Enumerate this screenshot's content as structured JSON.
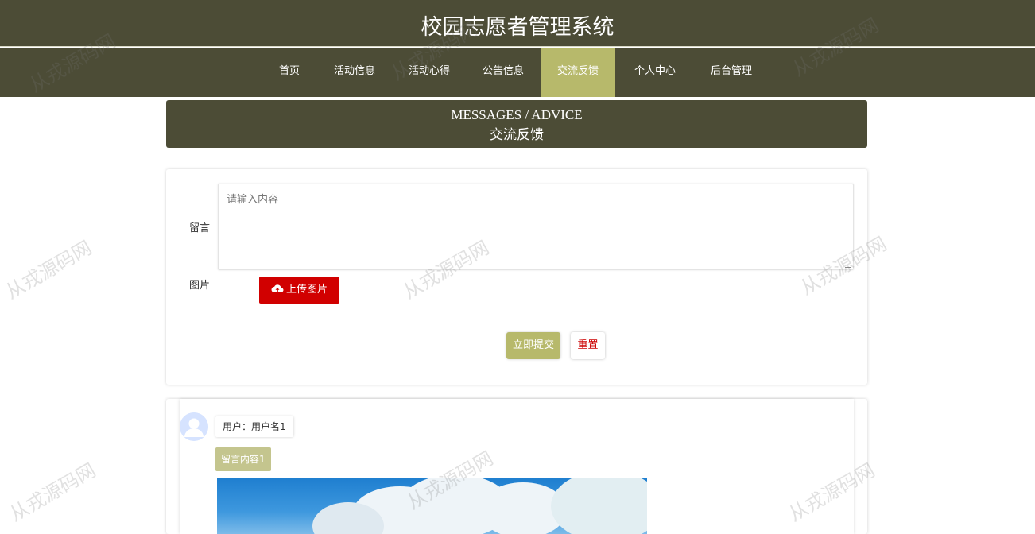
{
  "site": {
    "title": "校园志愿者管理系统"
  },
  "nav": {
    "items": [
      {
        "label": "首页"
      },
      {
        "label": "活动信息"
      },
      {
        "label": "活动心得"
      },
      {
        "label": "公告信息"
      },
      {
        "label": "交流反馈"
      },
      {
        "label": "个人中心"
      },
      {
        "label": "后台管理"
      }
    ],
    "active_index": 4,
    "active_color": "#b7b96b",
    "bg_color": "#4c4c36"
  },
  "banner": {
    "en": "MESSAGES / ADVICE",
    "zh": "交流反馈"
  },
  "form": {
    "message_label": "留言",
    "message_placeholder": "请输入内容",
    "image_label": "图片",
    "upload_label": "上传图片",
    "upload_icon": "cloud-upload-icon",
    "submit_label": "立即提交",
    "reset_label": "重置"
  },
  "messages": [
    {
      "user": "用户：用户名1",
      "content": "留言内容1"
    }
  ],
  "watermark": "从戎源码网"
}
